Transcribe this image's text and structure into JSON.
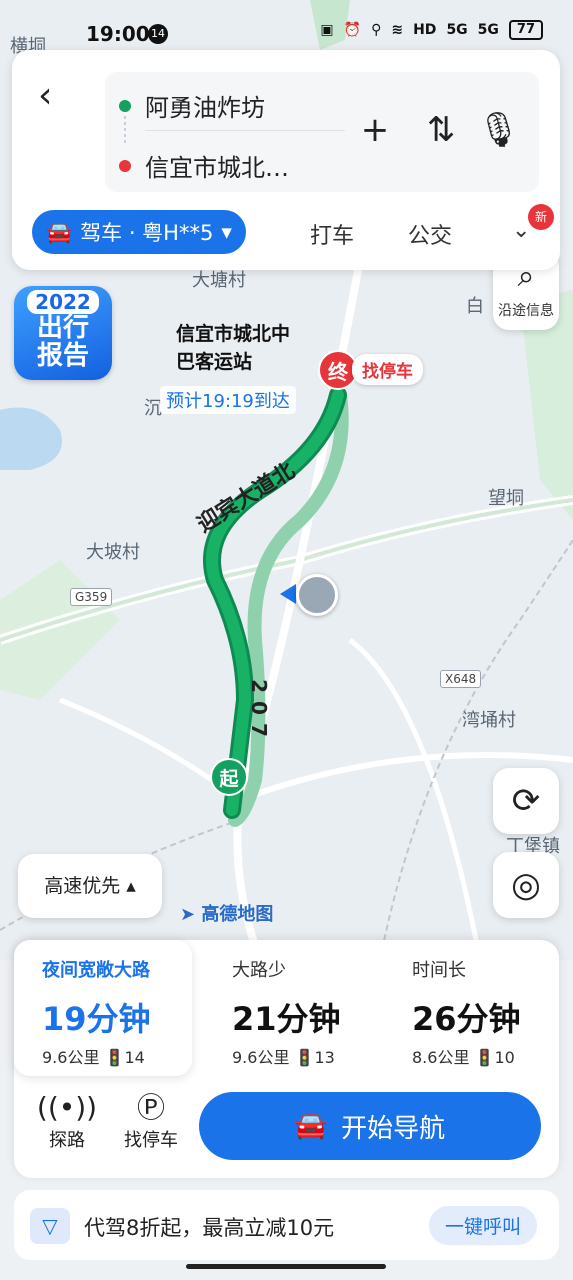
{
  "status_bar": {
    "time": "19:00",
    "notif_count": "14",
    "signal_label": "HD",
    "net1": "5G",
    "net2": "5G",
    "battery": "77"
  },
  "search": {
    "origin": "阿勇油炸坊",
    "destination": "信宜市城北…",
    "modes": {
      "active": "驾车 · 粤H**5",
      "taxi": "打车",
      "transit": "公交",
      "new_badge": "新"
    }
  },
  "map": {
    "labels": {
      "hengdong": "横垌",
      "datangcun": "大塘村",
      "dapocun": "大坡村",
      "wangdong": "望垌",
      "wantongcun": "湾埇村",
      "bao_town": "丁堡镇",
      "bai": "白",
      "shen": "沉"
    },
    "road_tags": {
      "g359": "G359",
      "x648": "X648"
    },
    "route_name": "迎宾大道北",
    "route_number": "207",
    "promo": {
      "year": "2022",
      "line1": "出行",
      "line2": "报告"
    },
    "destination_label_line1": "信宜市城北中",
    "destination_label_line2": "巴客运站",
    "eta": "预计19:19到达",
    "end_marker": "终",
    "start_marker": "起",
    "park_label": "找停车",
    "along_route": "沿途信息",
    "pref_button": "高速优先",
    "logo": "高德地图"
  },
  "route_options": [
    {
      "name": "夜间宽敞大路",
      "duration": "19分钟",
      "distance": "9.6公里",
      "lights": "14",
      "selected": true
    },
    {
      "name": "大路少",
      "duration": "21分钟",
      "distance": "9.6公里",
      "lights": "13",
      "selected": false
    },
    {
      "name": "时间长",
      "duration": "26分钟",
      "distance": "8.6公里",
      "lights": "10",
      "selected": false
    }
  ],
  "actions": {
    "explore": "探路",
    "parking": "找停车",
    "start_nav": "开始导航"
  },
  "banner": {
    "text": "代驾8折起，最高立减10元",
    "cta": "一键呼叫"
  },
  "colors": {
    "accent": "#1a73e8",
    "route_main": "#13a060",
    "route_alt": "#8fd1ad",
    "end_pin": "#e8343b"
  }
}
